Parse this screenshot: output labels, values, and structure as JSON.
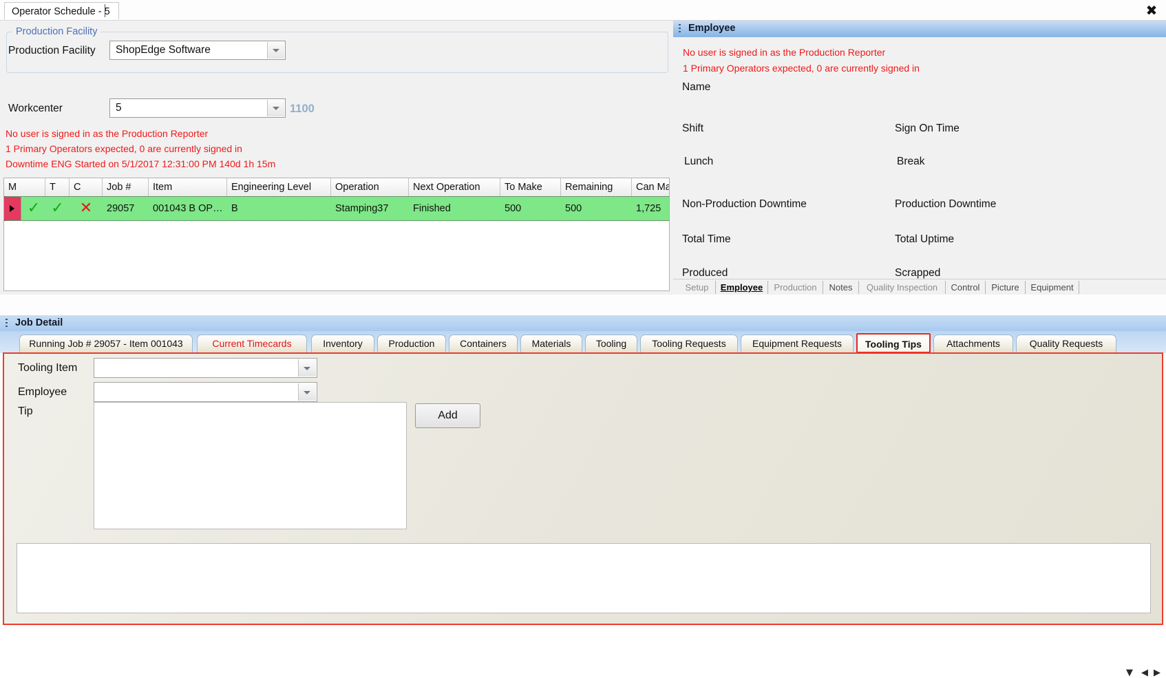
{
  "window": {
    "document_tab": "Operator Schedule - 5",
    "close_icon": "close-icon"
  },
  "left_panel": {
    "group_title": "Production Facility",
    "facility_label": "Production Facility",
    "facility_value": "ShopEdge Software",
    "workcenter_label": "Workcenter",
    "workcenter_value": "5",
    "workcenter_code": "1100",
    "warnings": [
      "No user is signed in as the Production Reporter",
      "1 Primary Operators expected, 0 are currently signed in",
      "Downtime ENG Started on 5/1/2017 12:31:00 PM 140d 1h 15m"
    ],
    "grid": {
      "columns": [
        "M",
        "T",
        "C",
        "Job #",
        "Item",
        "Engineering Level",
        "Operation",
        "Next Operation",
        "To Make",
        "Remaining",
        "Can Ma"
      ],
      "rows": [
        {
          "m": "✓",
          "t": "✓",
          "c": "✕",
          "job": "29057",
          "item": "001043  B  OP…",
          "engineering_level": "B",
          "operation": "Stamping37",
          "next_operation": "Finished",
          "to_make": "500",
          "remaining": "500",
          "can_make": "1,725"
        }
      ]
    }
  },
  "employee_panel": {
    "title": "Employee",
    "warnings": [
      "No user is signed in as the Production Reporter",
      "1 Primary Operators expected, 0 are currently signed in"
    ],
    "fields": [
      "Name",
      "Shift",
      "Sign On Time",
      "Lunch",
      "Break",
      "Non-Production Downtime",
      "Production Downtime",
      "Total Time",
      "Total Uptime",
      "Produced",
      "Scrapped"
    ],
    "tabs": [
      {
        "label": "Setup",
        "state": "dim"
      },
      {
        "label": "Employee",
        "state": "selected"
      },
      {
        "label": "Production",
        "state": "dim"
      },
      {
        "label": "Notes",
        "state": "normal"
      },
      {
        "label": "Quality Inspection",
        "state": "dim"
      },
      {
        "label": "Control",
        "state": "normal"
      },
      {
        "label": "Picture",
        "state": "normal"
      },
      {
        "label": "Equipment",
        "state": "normal"
      }
    ]
  },
  "job_detail": {
    "title": "Job Detail",
    "tabs": [
      {
        "label": "Running Job # 29057 - Item 001043",
        "style": "normal"
      },
      {
        "label": "Current Timecards",
        "style": "red"
      },
      {
        "label": "Inventory",
        "style": "normal"
      },
      {
        "label": "Production",
        "style": "normal"
      },
      {
        "label": "Containers",
        "style": "normal"
      },
      {
        "label": "Materials",
        "style": "normal"
      },
      {
        "label": "Tooling",
        "style": "normal"
      },
      {
        "label": "Tooling Requests",
        "style": "normal"
      },
      {
        "label": "Equipment Requests",
        "style": "normal"
      },
      {
        "label": "Tooling Tips",
        "style": "active"
      },
      {
        "label": "Attachments",
        "style": "normal"
      },
      {
        "label": "Quality Requests",
        "style": "normal"
      }
    ],
    "nav": {
      "dropdown_icon": "▼",
      "prev_icon": "◀",
      "next_icon": "▶"
    }
  },
  "tooling_tips": {
    "tooling_item_label": "Tooling Item",
    "tooling_item_value": "",
    "employee_label": "Employee",
    "employee_value": "",
    "tip_label": "Tip",
    "tip_value": "",
    "add_button": "Add"
  },
  "colors": {
    "accent_blue": "#86b4e4",
    "warning_red": "#f11818",
    "active_tab_border": "#e8281c",
    "row_green": "#7ee787",
    "row_indicator": "#e5395f",
    "workcenter_code": "#93aecb"
  }
}
